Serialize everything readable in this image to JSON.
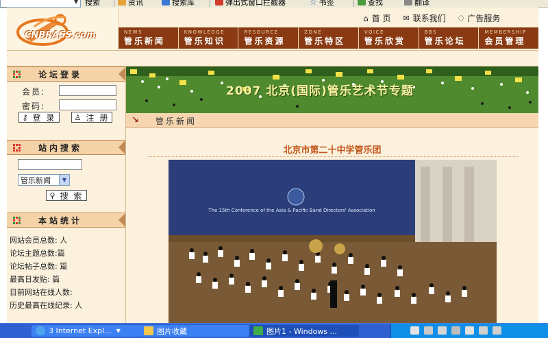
{
  "ie_toolbar": {
    "search_label": "搜索",
    "news_label": "资讯",
    "search_engine_label": "搜索库",
    "popup_blocker_label": "弹出式窗口拦截器",
    "bookmarks_label": "书签",
    "find_label": "查找",
    "translate_label": "翻译"
  },
  "header": {
    "logo_text": "CNBRASS.com",
    "top_links": {
      "home": "首 页",
      "contact": "联系我们",
      "ads": "广告服务"
    },
    "nav": [
      {
        "en": "NEWS",
        "cn": "管乐新闻"
      },
      {
        "en": "KNOWLEDGE",
        "cn": "管乐知识"
      },
      {
        "en": "RESOURCE",
        "cn": "管乐资源"
      },
      {
        "en": "ZONE",
        "cn": "管乐特区"
      },
      {
        "en": "VOICE",
        "cn": "管乐欣赏"
      },
      {
        "en": "BBS",
        "cn": "管乐论坛"
      },
      {
        "en": "MEMBERSHIP",
        "cn": "会员管理"
      }
    ]
  },
  "sidebar": {
    "login": {
      "title": "论坛登录",
      "member_label": "会员:",
      "password_label": "密码:",
      "login_button": "登 录",
      "register_button": "注 册"
    },
    "search": {
      "title": "站内搜索",
      "query_value": "",
      "category_selected": "管乐新闻",
      "search_button": "搜 索"
    },
    "stats": {
      "title": "本站统计",
      "lines": [
        "网站会员总数: 人",
        "论坛主题总数:篇",
        "论坛帖子总数: 篇",
        "最高日发贴: 篇",
        "目前网站在线人数:",
        "历史最高在线纪录: 人"
      ]
    }
  },
  "main": {
    "banner_title": "2007 北京(国际)管乐艺术节专题",
    "section_title": "管乐新闻",
    "article_title": "北京市第二十中学管乐团",
    "photo_banner_text": "The 15th Conference of the Asia & Pacific Band Directors' Association"
  },
  "taskbar": {
    "items": [
      {
        "label": "3 Internet Expl..."
      },
      {
        "label": "图片收藏"
      },
      {
        "label": "图片1 - Windows ..."
      }
    ]
  },
  "colors": {
    "nav_bg": "#8a3a12",
    "page_bg": "#fbf1dd",
    "panel_head_bg": "#f5d3a8",
    "article_title": "#c2561c",
    "taskbar_bg": "#2f5fd0"
  }
}
